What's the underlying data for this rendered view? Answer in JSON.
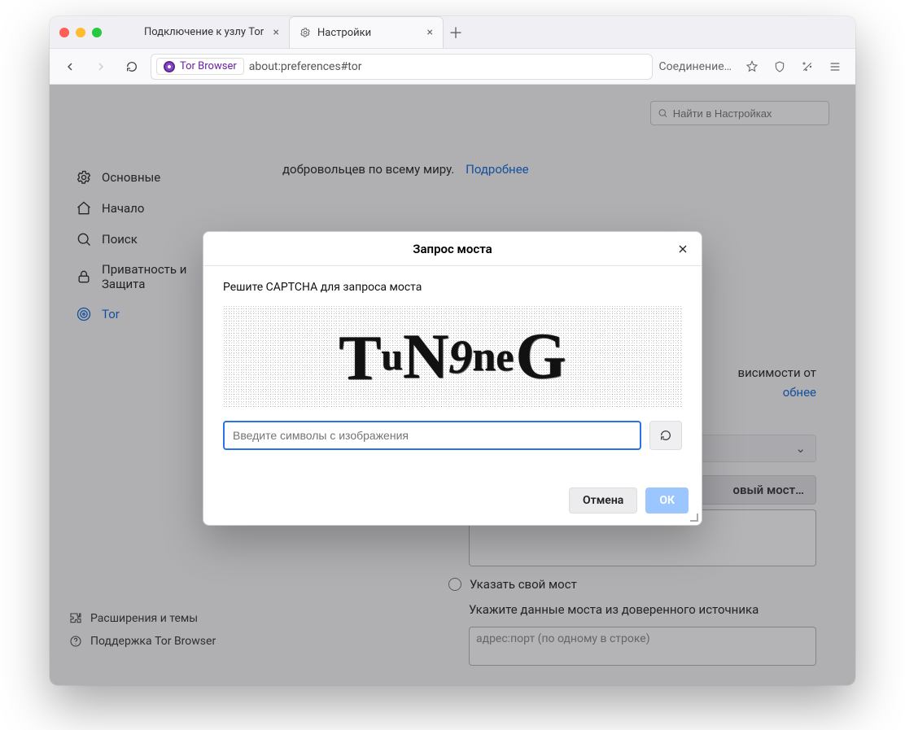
{
  "tabs": {
    "inactive": {
      "label": "Подключение к узлу Tor"
    },
    "active": {
      "label": "Настройки"
    }
  },
  "toolbar": {
    "brand": "Tor Browser",
    "url": "about:preferences#tor",
    "connection": "Соединение…"
  },
  "search": {
    "placeholder": "Найти в Настройках"
  },
  "sidebar": {
    "general": "Основные",
    "home": "Начало",
    "search": "Поиск",
    "privacy": "Приватность и Защита",
    "tor": "Tor",
    "extensions": "Расширения и темы",
    "support": "Поддержка Tor Browser"
  },
  "intro": {
    "line": "добровольцев по всему миру.",
    "more": "Подробнее"
  },
  "peek": {
    "left": "висимости от",
    "more": "обнее"
  },
  "buttons": {
    "newbridge": "овый мост…"
  },
  "radio": {
    "ownbridge": "Указать свой мост"
  },
  "hints": {
    "trusted": "Укажите данные моста из доверенного источника",
    "bridgeplaceholder": "адрес:порт (по одному в строке)"
  },
  "modal": {
    "title": "Запрос моста",
    "instruction": "Решите CAPTCHA для запроса моста",
    "captcha_text": "TuN9neG",
    "input_placeholder": "Введите символы с изображения",
    "cancel": "Отмена",
    "ok": "ОК"
  }
}
